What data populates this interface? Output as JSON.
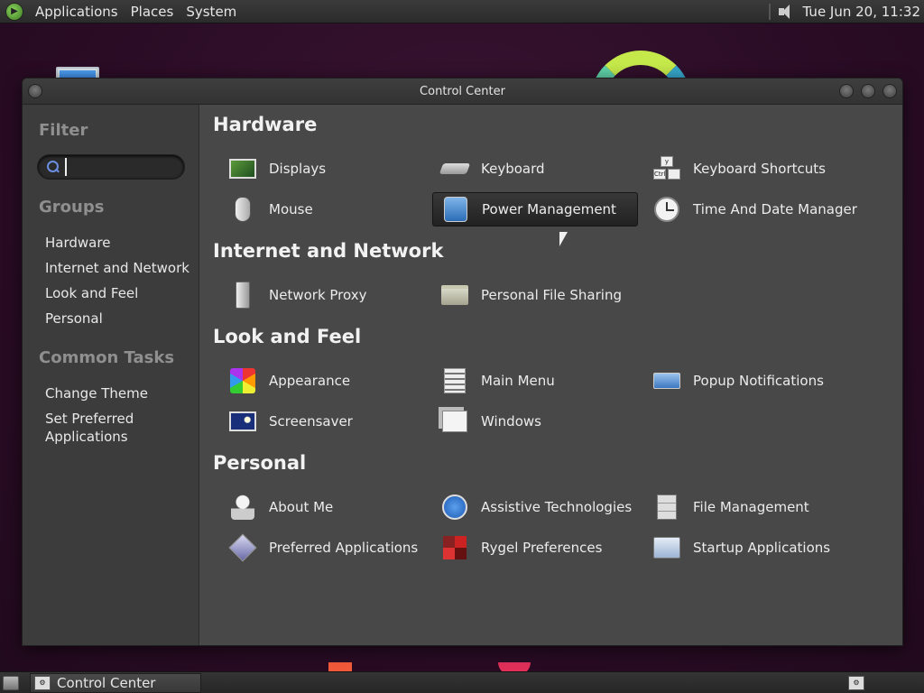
{
  "top_panel": {
    "menus": [
      "Applications",
      "Places",
      "System"
    ],
    "clock": "Tue Jun 20, 11:32"
  },
  "window": {
    "title": "Control Center"
  },
  "sidebar": {
    "filter_heading": "Filter",
    "search": {
      "value": "",
      "placeholder": ""
    },
    "groups_heading": "Groups",
    "groups": [
      "Hardware",
      "Internet and Network",
      "Look and Feel",
      "Personal"
    ],
    "tasks_heading": "Common Tasks",
    "tasks": [
      "Change Theme",
      "Set Preferred Applications"
    ]
  },
  "sections": [
    {
      "title": "Hardware",
      "items": [
        {
          "label": "Displays",
          "icon": "display-icon"
        },
        {
          "label": "Keyboard",
          "icon": "keyboard-icon"
        },
        {
          "label": "Keyboard Shortcuts",
          "icon": "keyboard-shortcuts-icon"
        },
        {
          "label": "Mouse",
          "icon": "mouse-icon"
        },
        {
          "label": "Power Management",
          "icon": "power-management-icon",
          "selected": true
        },
        {
          "label": "Time And Date Manager",
          "icon": "clock-icon"
        }
      ]
    },
    {
      "title": "Internet and Network",
      "items": [
        {
          "label": "Network Proxy",
          "icon": "network-proxy-icon"
        },
        {
          "label": "Personal File Sharing",
          "icon": "file-sharing-icon"
        }
      ]
    },
    {
      "title": "Look and Feel",
      "items": [
        {
          "label": "Appearance",
          "icon": "appearance-icon"
        },
        {
          "label": "Main Menu",
          "icon": "main-menu-icon"
        },
        {
          "label": "Popup Notifications",
          "icon": "popup-notifications-icon"
        },
        {
          "label": "Screensaver",
          "icon": "screensaver-icon"
        },
        {
          "label": "Windows",
          "icon": "windows-icon"
        }
      ]
    },
    {
      "title": "Personal",
      "items": [
        {
          "label": "About Me",
          "icon": "about-me-icon"
        },
        {
          "label": "Assistive Technologies",
          "icon": "accessibility-icon"
        },
        {
          "label": "File Management",
          "icon": "file-management-icon"
        },
        {
          "label": "Preferred Applications",
          "icon": "preferred-applications-icon"
        },
        {
          "label": "Rygel Preferences",
          "icon": "rygel-icon"
        },
        {
          "label": "Startup Applications",
          "icon": "startup-applications-icon"
        }
      ]
    }
  ],
  "taskbar": {
    "task_label": "Control Center"
  }
}
